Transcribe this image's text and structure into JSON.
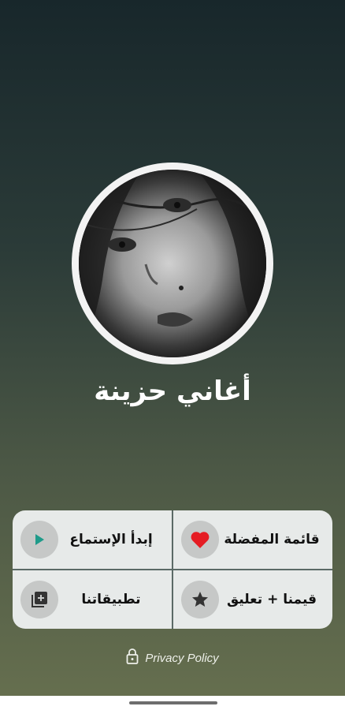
{
  "app": {
    "title": "أغاني حزينة"
  },
  "menu": {
    "items": [
      {
        "label": "قائمة المفضلة",
        "icon": "heart-icon"
      },
      {
        "label": "إبدأ الإستماع",
        "icon": "play-icon"
      },
      {
        "label": "قيمنا + تعليق",
        "icon": "star-icon"
      },
      {
        "label": "تطبيقاتنا",
        "icon": "library-add-icon"
      }
    ]
  },
  "footer": {
    "privacy_label": "Privacy Policy",
    "icon": "lock-icon"
  },
  "colors": {
    "heart": "#e51c23",
    "play": "#1f9b8a",
    "menu_bg": "#e7eae9"
  }
}
